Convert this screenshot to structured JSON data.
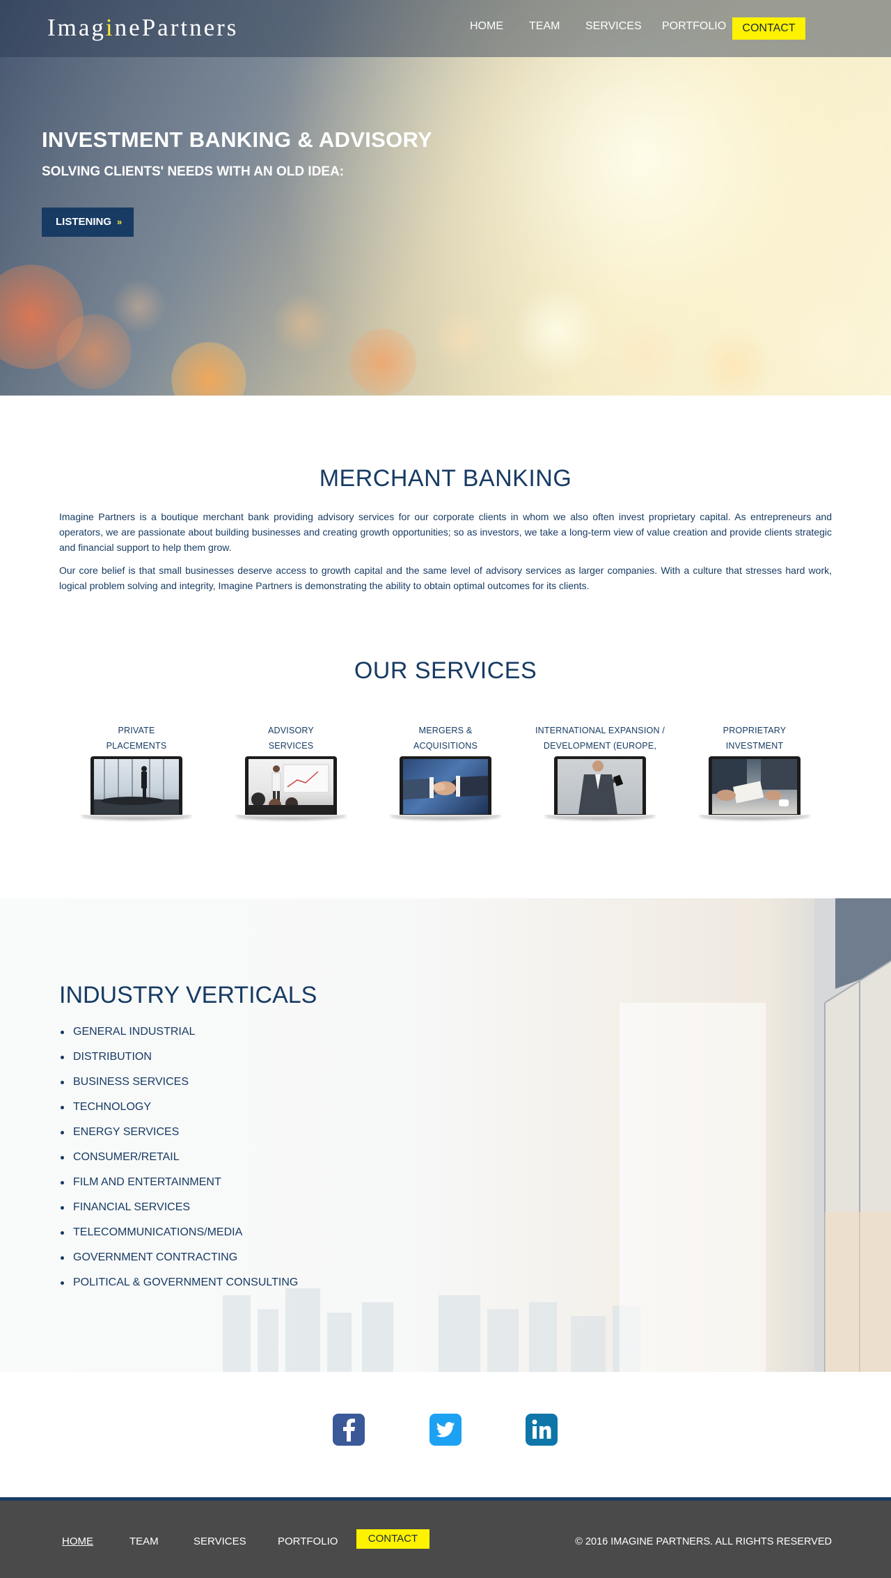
{
  "header": {
    "logo_text_1": "Imag",
    "logo_dot": "i",
    "logo_text_2": "nePartners",
    "nav": [
      "HOME",
      "TEAM",
      "SERVICES",
      "PORTFOLIO"
    ],
    "contact": "CONTACT"
  },
  "hero": {
    "title": "INVESTMENT BANKING & ADVISORY",
    "subtitle": "SOLVING CLIENTS' NEEDS WITH AN OLD IDEA:",
    "button": "LISTENING",
    "button_icon": "»"
  },
  "merchant": {
    "title": "MERCHANT BANKING",
    "p1": "Imagine Partners is a boutique merchant bank providing advisory services for our corporate clients in whom we also often invest proprietary capital. As entrepreneurs and operators, we are passionate about building businesses and creating growth opportunities; so as investors, we take a long-term view of value creation and provide clients strategic and financial support to help them grow.",
    "p2": "Our core belief is that small businesses deserve access to growth capital and the same level of advisory services as larger companies. With a culture that stresses hard work, logical problem solving and integrity, Imagine Partners is demonstrating the ability to obtain optimal outcomes for its clients."
  },
  "services": {
    "title": "OUR SERVICES",
    "items": [
      {
        "line1": "PRIVATE",
        "line2": "PLACEMENTS"
      },
      {
        "line1": "ADVISORY",
        "line2": "SERVICES"
      },
      {
        "line1": "MERGERS &",
        "line2": "ACQUISITIONS"
      },
      {
        "line1": "INTERNATIONAL EXPANSION /",
        "line2": "DEVELOPMENT (EUROPE, CHINA)"
      },
      {
        "line1": "PROPRIETARY",
        "line2": "INVESTMENT"
      }
    ]
  },
  "industry": {
    "title": "INDUSTRY VERTICALS",
    "items": [
      "GENERAL INDUSTRIAL",
      "DISTRIBUTION",
      "BUSINESS SERVICES",
      "TECHNOLOGY",
      "ENERGY SERVICES",
      "CONSUMER/RETAIL",
      "FILM AND ENTERTAINMENT",
      "FINANCIAL SERVICES",
      "TELECOMMUNICATIONS/MEDIA",
      "GOVERNMENT CONTRACTING",
      "POLITICAL & GOVERNMENT CONSULTING"
    ]
  },
  "social": {
    "facebook_color": "#3b5998",
    "twitter_color": "#1da1f2",
    "linkedin_color": "#0e76a8"
  },
  "footer": {
    "nav": [
      "HOME",
      "TEAM",
      "SERVICES",
      "PORTFOLIO"
    ],
    "contact": "CONTACT",
    "copyright": "© 2016 IMAGINE PARTNERS. ALL RIGHTS RESERVED"
  }
}
